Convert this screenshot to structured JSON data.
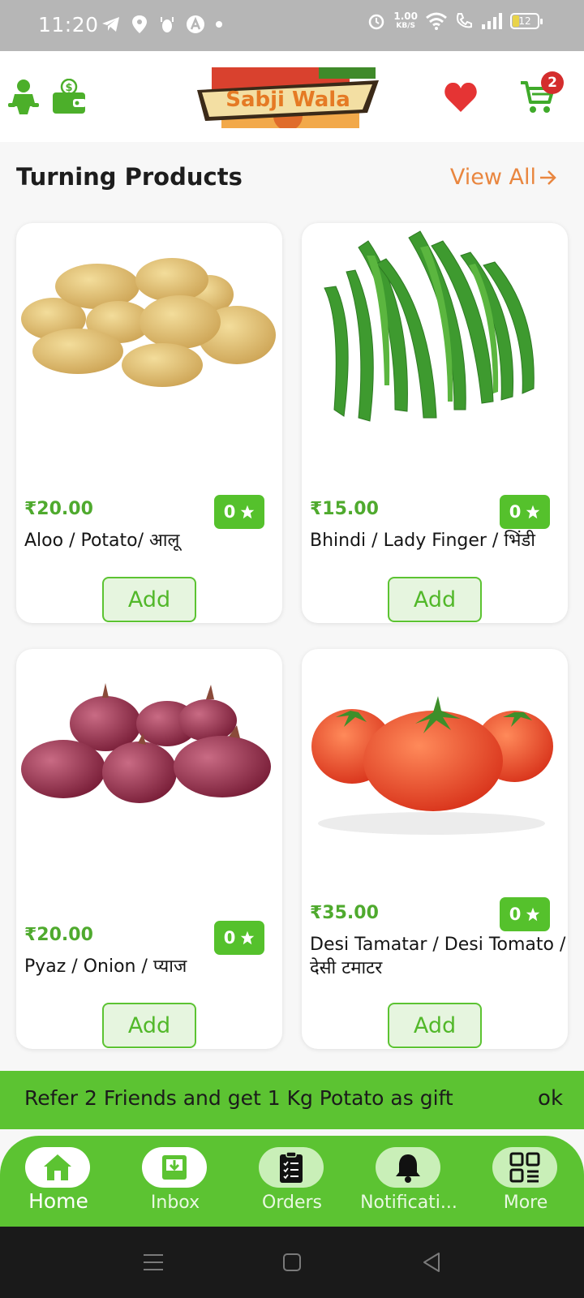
{
  "status_bar": {
    "time": "11:20",
    "net_speed": "1.00",
    "net_unit": "KB/S",
    "battery": "12"
  },
  "header": {
    "logo_text": "Sabji Wala",
    "cart_count": "2",
    "icons": [
      "profile-icon",
      "wallet-icon",
      "heart-icon",
      "cart-icon"
    ]
  },
  "section": {
    "title": "Turning Products",
    "view_all": "View All"
  },
  "products": [
    {
      "price": "₹20.00",
      "rating": "0",
      "name": "Aloo / Potato/ आलू",
      "add": "Add"
    },
    {
      "price": "₹15.00",
      "rating": "0",
      "name": "Bhindi / Lady Finger / भिंडी",
      "add": "Add"
    },
    {
      "price": "₹20.00",
      "rating": "0",
      "name": "Pyaz / Onion /  प्याज",
      "add": "Add"
    },
    {
      "price": "₹35.00",
      "rating": "0",
      "name": "Desi Tamatar / Desi Tomato /  देसी टमाटर",
      "add": "Add"
    }
  ],
  "refer": {
    "message": "Refer 2 Friends and get 1 Kg Potato as gift",
    "ok": "ok"
  },
  "bottom_nav": [
    {
      "label": "Home",
      "icon": "home-icon",
      "active": true
    },
    {
      "label": "Inbox",
      "icon": "inbox-icon"
    },
    {
      "label": "Orders",
      "icon": "orders-icon"
    },
    {
      "label": "Notificati...",
      "icon": "bell-icon"
    },
    {
      "label": "More",
      "icon": "grid-icon"
    }
  ],
  "colors": {
    "brand_green": "#5cc332",
    "price_green": "#4faa2e",
    "view_all_orange": "#e9863f",
    "badge_red": "#d42d2d"
  }
}
